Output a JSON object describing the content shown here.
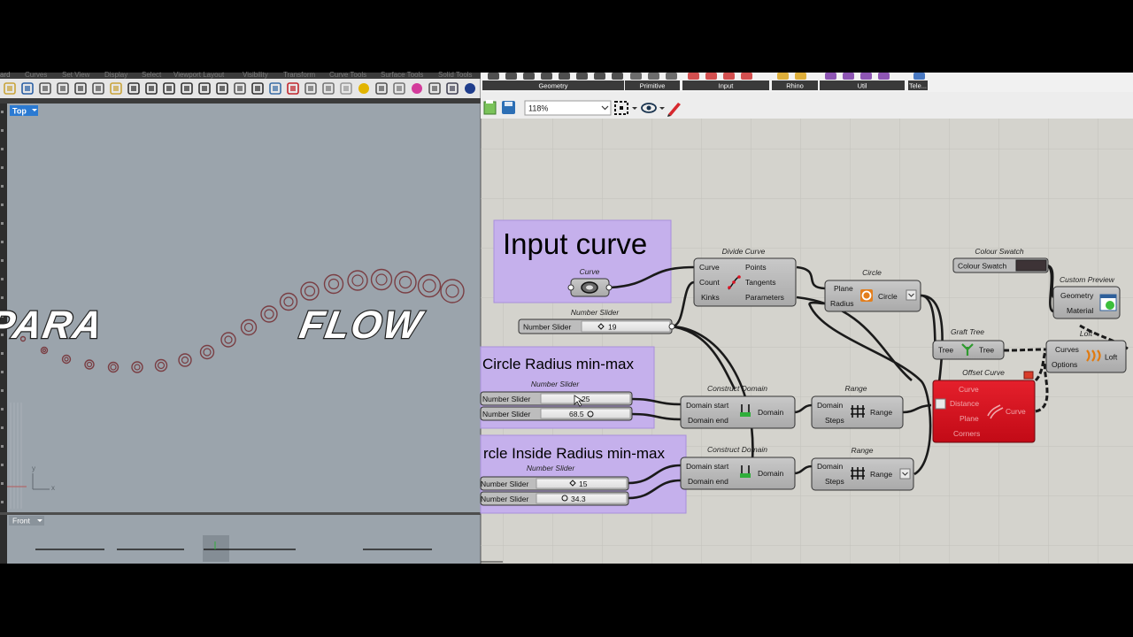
{
  "rhino": {
    "menu_items": [
      "Curves",
      "Set View",
      "Display",
      "Select",
      "Viewport Layout",
      "Visibility",
      "Transform",
      "Curve Tools",
      "Surface Tools",
      "Solid Tools"
    ],
    "menu_fragment": "ard",
    "viewport_top_label": "Top",
    "viewport_front_label": "Front",
    "axis_y": "y",
    "axis_x": "x",
    "logo_left": "PARA",
    "logo_right": "FLOW"
  },
  "grasshopper": {
    "tab_groups": [
      "Geometry",
      "Primitive",
      "Input",
      "Rhino",
      "Util",
      "Tele..."
    ],
    "zoom": "118%",
    "groups": {
      "input_curve": "Input curve",
      "circle_radius": "Circle Radius min-max",
      "inside_radius": "rcle Inside Radius min-max"
    },
    "components": {
      "curve_param": {
        "title": "Curve"
      },
      "number_slider_main": {
        "title": "Number Slider",
        "label": "Number Slider",
        "value": "19"
      },
      "divide_curve": {
        "title": "Divide Curve",
        "inputs": [
          "Curve",
          "Count",
          "Kinks"
        ],
        "outputs": [
          "Points",
          "Tangents",
          "Parameters"
        ]
      },
      "circle": {
        "title": "Circle",
        "inputs": [
          "Plane",
          "Radius"
        ],
        "output": "Circle"
      },
      "colour_swatch": {
        "title": "Colour Swatch",
        "label": "Colour Swatch",
        "color": "#3d3336"
      },
      "custom_preview": {
        "title": "Custom Preview",
        "inputs": [
          "Geometry",
          "Material"
        ]
      },
      "graft_tree": {
        "title": "Graft Tree",
        "input": "Tree",
        "output": "Tree"
      },
      "loft": {
        "title": "Loft",
        "inputs": [
          "Curves",
          "Options"
        ],
        "output": "Loft"
      },
      "offset_curve": {
        "title": "Offset Curve",
        "inputs": [
          "Curve",
          "Distance",
          "Plane",
          "Corners"
        ],
        "output": "Curve"
      },
      "slider_radius_min": {
        "title": "Number Slider",
        "label": "Number Slider",
        "value": "25"
      },
      "slider_radius_max": {
        "label": "Number Slider",
        "value": "68.5"
      },
      "construct_domain_1": {
        "title": "Construct Domain",
        "inputs": [
          "Domain start",
          "Domain end"
        ],
        "output": "Domain"
      },
      "range_1": {
        "title": "Range",
        "inputs": [
          "Domain",
          "Steps"
        ],
        "output": "Range"
      },
      "slider_inside_min": {
        "title": "Number Slider",
        "label": "Number Slider",
        "value": "15"
      },
      "slider_inside_max": {
        "label": "Number Slider",
        "value": "34.3"
      },
      "construct_domain_2": {
        "title": "Construct Domain",
        "inputs": [
          "Domain start",
          "Domain end"
        ],
        "output": "Domain"
      },
      "range_2": {
        "title": "Range",
        "inputs": [
          "Domain",
          "Steps"
        ],
        "output": "Range"
      }
    }
  },
  "colors": {
    "group_purple": "#c5b0ec",
    "canvas": "#d4d3cd",
    "rhino_viewport": "#9aa3ab",
    "offset_red": "#d60f1c"
  }
}
